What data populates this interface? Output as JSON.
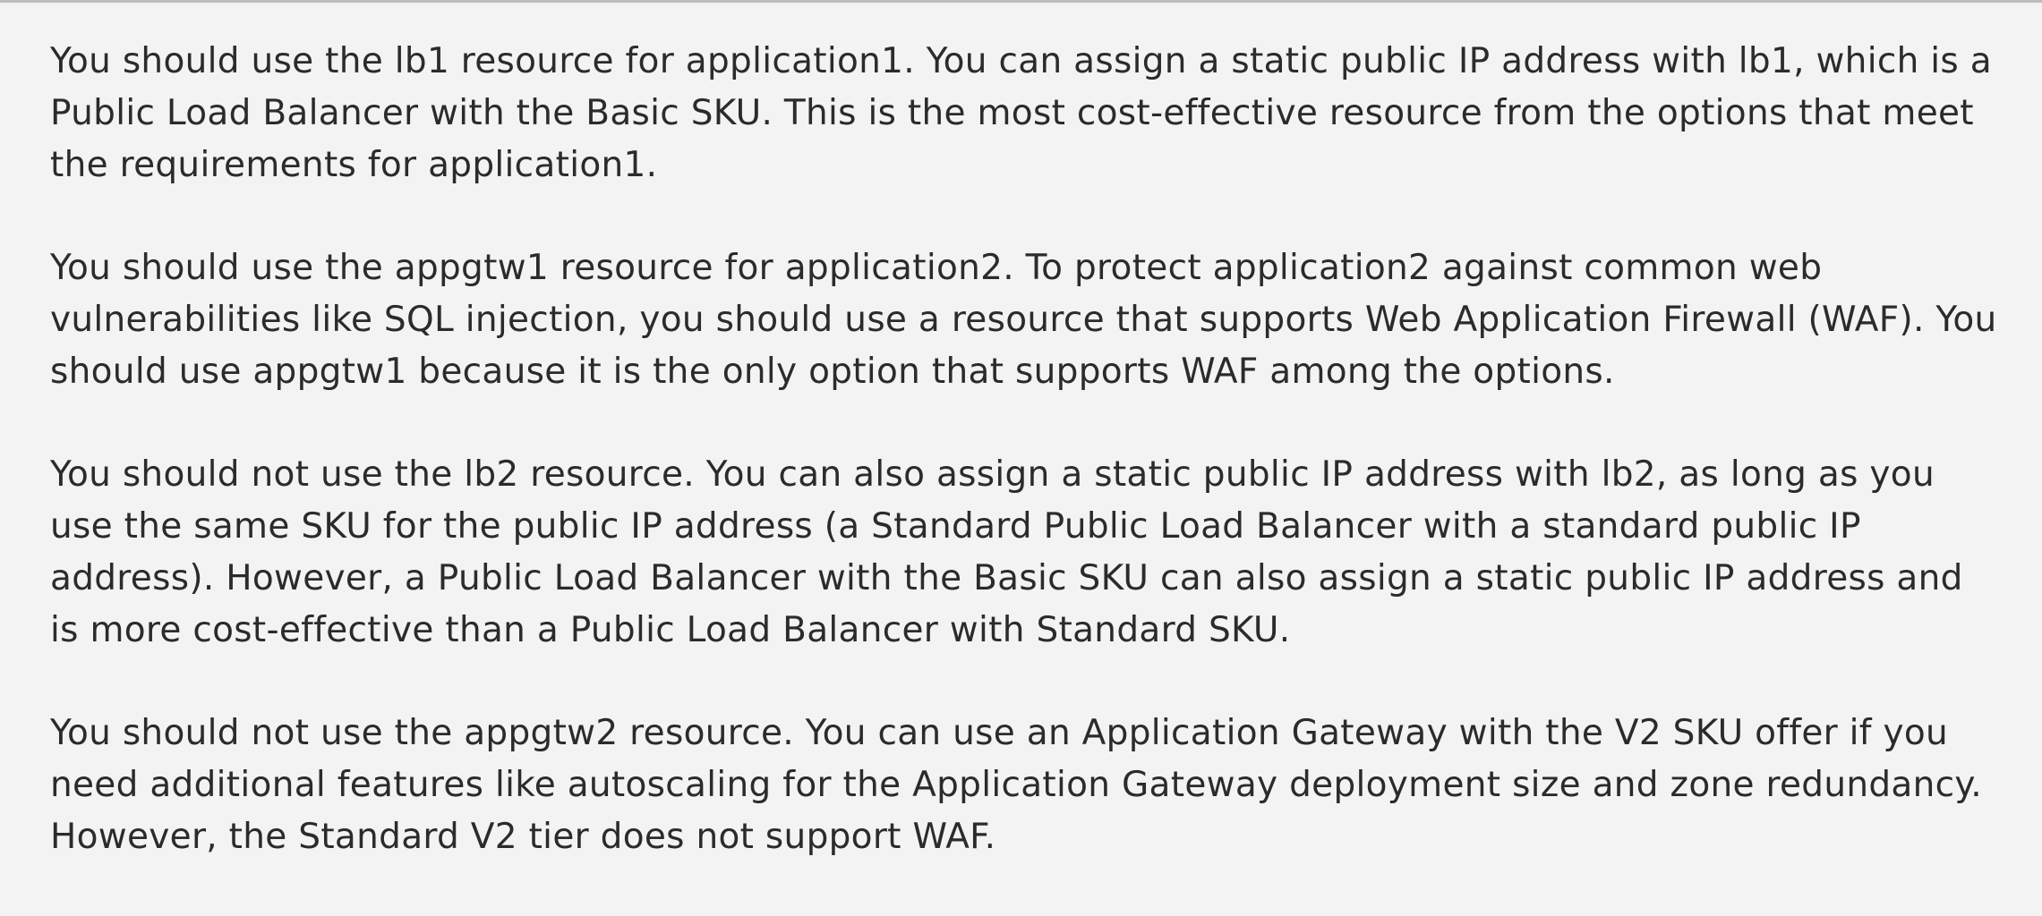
{
  "explanation": {
    "paragraphs": [
      "You should use the lb1 resource for application1. You can assign a static public IP address with lb1, which is a Public Load Balancer with the Basic SKU. This is the most cost-effective resource from the options that meet the requirements for application1.",
      "You should use the appgtw1 resource for application2. To protect application2 against common web vulnerabilities like SQL injection, you should use a resource that supports Web Application Firewall (WAF). You should use appgtw1 because it is the only option that supports WAF among the options.",
      "You should not use the lb2 resource. You can also assign a static public IP address with lb2, as long as you use the same SKU for the public IP address (a Standard Public Load Balancer with a standard public IP address). However, a Public Load Balancer with the Basic SKU can also assign a static public IP address and is more cost-effective than a Public Load Balancer with Standard SKU.",
      "You should not use the appgtw2 resource. You can use an Application Gateway with the V2 SKU offer if you need additional features like autoscaling for the Application Gateway deployment size and zone redundancy. However, the Standard V2 tier does not support WAF."
    ]
  }
}
